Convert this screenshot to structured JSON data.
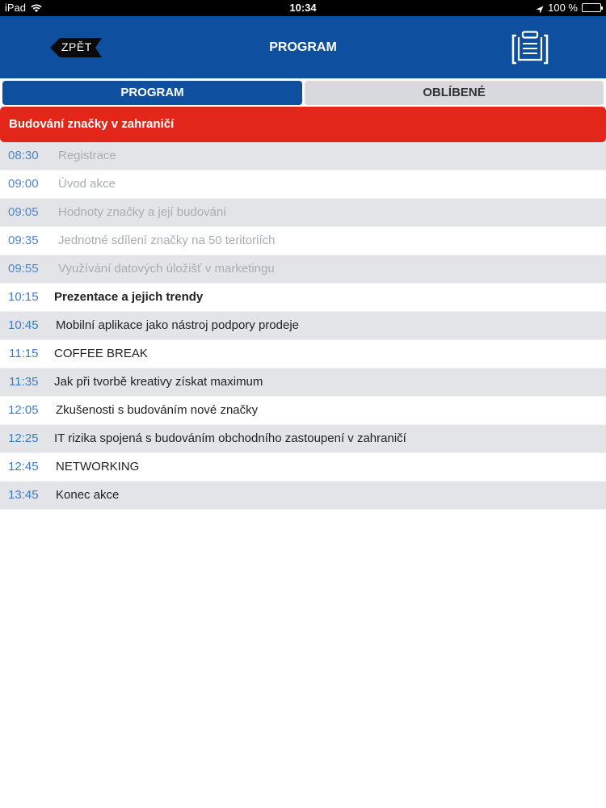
{
  "status_bar": {
    "device": "iPad",
    "time": "10:34",
    "battery": "100 %",
    "battery_level": 1.0
  },
  "header": {
    "back_label": "ZPĚT",
    "title": "PROGRAM",
    "clipboard_icon": "clipboard-icon"
  },
  "tabs": [
    {
      "label": "PROGRAM",
      "active": true
    },
    {
      "label": "OBLÍBENÉ",
      "active": false
    }
  ],
  "section": {
    "title": "Budování značky v zahraničí",
    "color": "#e3261a"
  },
  "schedule": [
    {
      "time": "08:30",
      "title": "Registrace",
      "state": "past"
    },
    {
      "time": "09:00",
      "title": "Úvod akce",
      "state": "past"
    },
    {
      "time": "09:05",
      "title": "Hodnoty značky a její budování",
      "state": "past"
    },
    {
      "time": "09:35",
      "title": "Jednotné sdílení značky na 50 teritoriích",
      "state": "past"
    },
    {
      "time": "09:55",
      "title": "Využívání datových úložišť v marketingu",
      "state": "past"
    },
    {
      "time": "10:15",
      "title": "Prezentace a jejich trendy",
      "state": "current"
    },
    {
      "time": "10:45",
      "title": "Mobilní aplikace jako nástroj podpory prodeje",
      "state": "upcoming"
    },
    {
      "time": "11:15",
      "title": "COFFEE BREAK",
      "state": "upcoming"
    },
    {
      "time": "11:35",
      "title": "Jak při tvorbě kreativy získat maximum",
      "state": "upcoming"
    },
    {
      "time": "12:05",
      "title": "Zkušenosti s budováním nové značky",
      "state": "upcoming"
    },
    {
      "time": "12:25",
      "title": "IT rizika spojená s budováním obchodního zastoupení v zahraničí",
      "state": "upcoming"
    },
    {
      "time": "12:45",
      "title": "NETWORKING",
      "state": "upcoming"
    },
    {
      "time": "13:45",
      "title": "Konec akce",
      "state": "upcoming"
    }
  ],
  "colors": {
    "brand_blue": "#0f4f9f",
    "time_blue": "#3d7cc4",
    "row_alt": "#e3e4e8"
  }
}
